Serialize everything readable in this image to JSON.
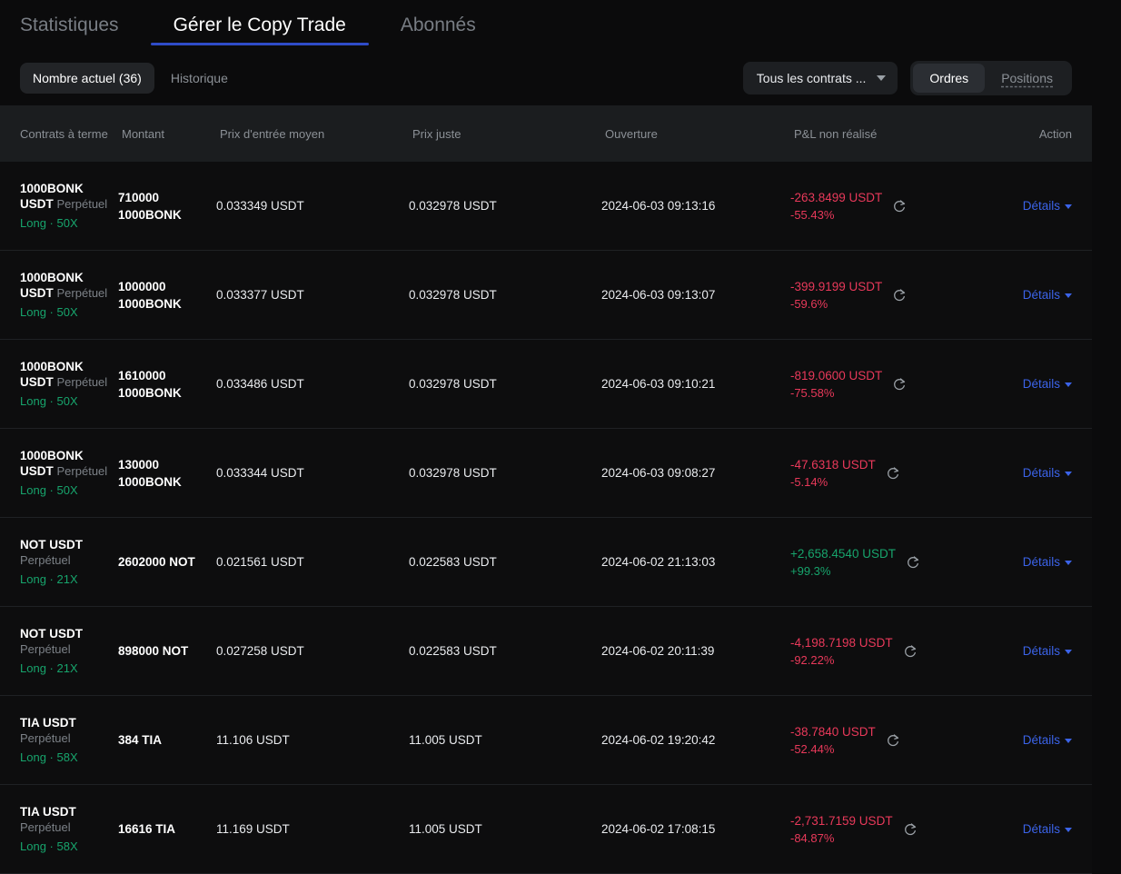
{
  "tabs": [
    {
      "label": "Statistiques",
      "active": false
    },
    {
      "label": "Gérer le Copy Trade",
      "active": true
    },
    {
      "label": "Abonnés",
      "active": false
    }
  ],
  "toolbar": {
    "segments": [
      {
        "label": "Nombre actuel (36)",
        "active": true
      },
      {
        "label": "Historique",
        "active": false
      }
    ],
    "contract_filter": {
      "value": "Tous les contrats ...",
      "icon": "chevron-down-icon"
    },
    "view_toggle": [
      {
        "label": "Ordres",
        "active": true
      },
      {
        "label": "Positions",
        "active": false,
        "dashed": true
      }
    ]
  },
  "table": {
    "columns": [
      "Contrats à terme",
      "Montant",
      "Prix d'entrée moyen",
      "Prix juste",
      "Ouverture",
      "P&L non réalisé",
      "Action"
    ],
    "action_label": "Détails",
    "refresh_icon": "refresh-icon",
    "rows": [
      {
        "symbol": "1000BONK USDT",
        "kind": "Perpétuel",
        "side": "Long",
        "leverage": "50X",
        "amount": "710000 1000BONK",
        "entry_price": "0.033349 USDT",
        "fair_price": "0.032978 USDT",
        "opened_at": "2024-06-03 09:13:16",
        "pnl": "-263.8499 USDT",
        "pnl_pct": "-55.43%",
        "pnl_sign": "negative"
      },
      {
        "symbol": "1000BONK USDT",
        "kind": "Perpétuel",
        "side": "Long",
        "leverage": "50X",
        "amount": "1000000 1000BONK",
        "entry_price": "0.033377 USDT",
        "fair_price": "0.032978 USDT",
        "opened_at": "2024-06-03 09:13:07",
        "pnl": "-399.9199 USDT",
        "pnl_pct": "-59.6%",
        "pnl_sign": "negative"
      },
      {
        "symbol": "1000BONK USDT",
        "kind": "Perpétuel",
        "side": "Long",
        "leverage": "50X",
        "amount": "1610000 1000BONK",
        "entry_price": "0.033486 USDT",
        "fair_price": "0.032978 USDT",
        "opened_at": "2024-06-03 09:10:21",
        "pnl": "-819.0600 USDT",
        "pnl_pct": "-75.58%",
        "pnl_sign": "negative"
      },
      {
        "symbol": "1000BONK USDT",
        "kind": "Perpétuel",
        "side": "Long",
        "leverage": "50X",
        "amount": "130000 1000BONK",
        "entry_price": "0.033344 USDT",
        "fair_price": "0.032978 USDT",
        "opened_at": "2024-06-03 09:08:27",
        "pnl": "-47.6318 USDT",
        "pnl_pct": "-5.14%",
        "pnl_sign": "negative"
      },
      {
        "symbol": "NOT USDT",
        "kind": "Perpétuel",
        "side": "Long",
        "leverage": "21X",
        "amount": "2602000 NOT",
        "entry_price": "0.021561 USDT",
        "fair_price": "0.022583 USDT",
        "opened_at": "2024-06-02 21:13:03",
        "pnl": "+2,658.4540 USDT",
        "pnl_pct": "+99.3%",
        "pnl_sign": "positive"
      },
      {
        "symbol": "NOT USDT",
        "kind": "Perpétuel",
        "side": "Long",
        "leverage": "21X",
        "amount": "898000 NOT",
        "entry_price": "0.027258 USDT",
        "fair_price": "0.022583 USDT",
        "opened_at": "2024-06-02 20:11:39",
        "pnl": "-4,198.7198 USDT",
        "pnl_pct": "-92.22%",
        "pnl_sign": "negative"
      },
      {
        "symbol": "TIA USDT",
        "kind": "Perpétuel",
        "side": "Long",
        "leverage": "58X",
        "amount": "384 TIA",
        "entry_price": "11.106 USDT",
        "fair_price": "11.005 USDT",
        "opened_at": "2024-06-02 19:20:42",
        "pnl": "-38.7840 USDT",
        "pnl_pct": "-52.44%",
        "pnl_sign": "negative"
      },
      {
        "symbol": "TIA USDT",
        "kind": "Perpétuel",
        "side": "Long",
        "leverage": "58X",
        "amount": "16616 TIA",
        "entry_price": "11.169 USDT",
        "fair_price": "11.005 USDT",
        "opened_at": "2024-06-02 17:08:15",
        "pnl": "-2,731.7159 USDT",
        "pnl_pct": "-84.87%",
        "pnl_sign": "negative"
      }
    ]
  },
  "colors": {
    "accent_tab": "#2f4cc8",
    "link": "#3b63e8",
    "positive": "#17a46c",
    "negative": "#e8395a",
    "background": "#0b0b0c",
    "header_background": "#1b1d1f"
  }
}
